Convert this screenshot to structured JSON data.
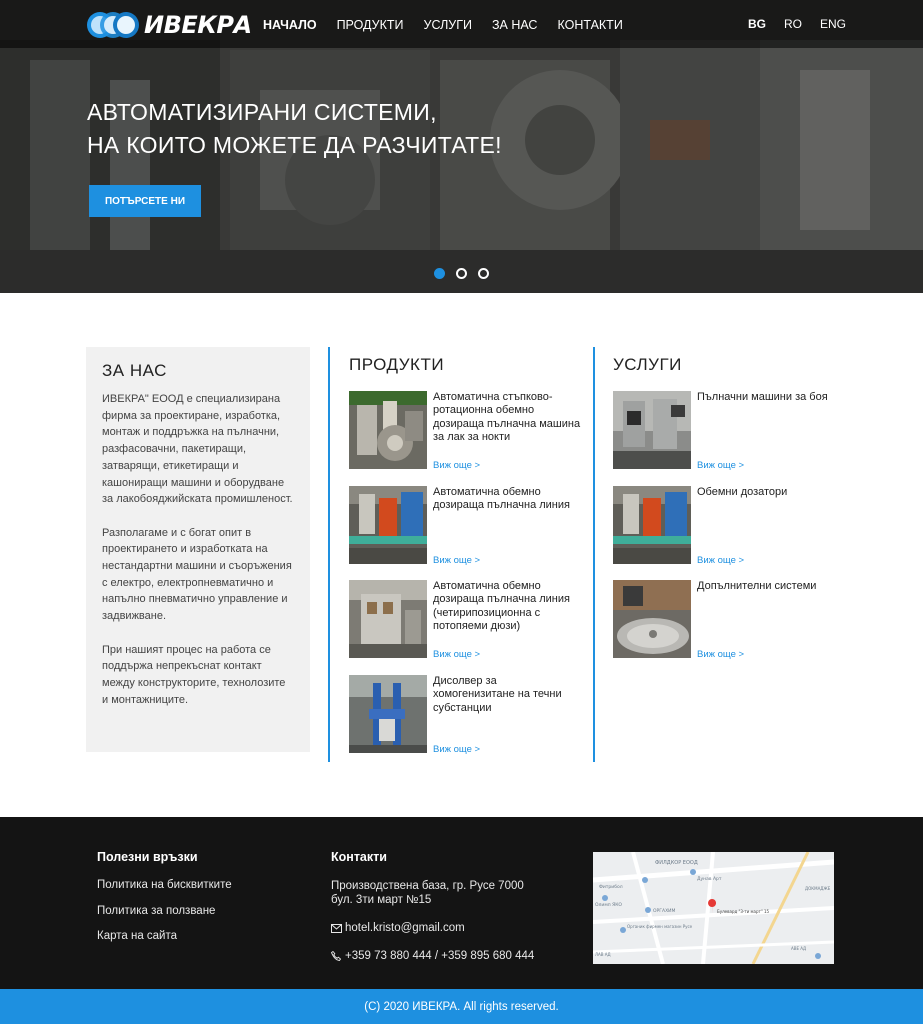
{
  "brand": {
    "name": "ИВЕКРА",
    "accent": "#1e90e0",
    "footer_bg": "#141414"
  },
  "nav": {
    "items": [
      "НАЧАЛО",
      "ПРОДУКТИ",
      "УСЛУГИ",
      "ЗА НАС",
      "КОНТАКТИ"
    ],
    "active": "НАЧАЛО"
  },
  "languages": {
    "items": [
      "BG",
      "RO",
      "ENG"
    ],
    "active": "BG"
  },
  "hero": {
    "title_line1": "АВТОМАТИЗИРАНИ СИСТЕМИ,",
    "title_line2": "НА КОИТО МОЖЕТЕ ДА РАЗЧИТАТЕ!",
    "button": "ПОТЪРСЕТЕ НИ",
    "slides": 3,
    "active_slide": 1
  },
  "about": {
    "title": "ЗА НАС",
    "paragraphs": [
      "ИВЕКРА\" ЕООД е специализирана фирма за проектиране, изработка, монтаж и поддръжка на пълначни, разфасовачни, пакетиращи, затварящи, етикетиращи и кашониращи машини и оборудване за лакобояджийската промишленост.",
      "Разполагаме и с богат опит в проектирането и изработката на нестандартни машини и съоръжения с електро, електропневматично и напълно пневматично управление и задвижване.",
      " При нашият процес на работа се поддържа непрекъснат контакт между конструкторите, технолозите и монтажниците."
    ]
  },
  "products": {
    "title": "ПРОДУКТИ",
    "link_label": "Виж още >",
    "items": [
      {
        "title": "Автоматична стъпково-ротационна обемно дозираща пълначна машина за лак за нокти",
        "thumb_icon": "filling-machine-photo"
      },
      {
        "title": "Автоматична обемно дозираща пълначна линия",
        "thumb_icon": "filling-line-photo"
      },
      {
        "title": "Автоматична обемно дозираща пълначна линия (четирипозиционна с потопяеми дюзи)",
        "thumb_icon": "four-position-line-photo"
      },
      {
        "title": "Дисолвер за хомогенизитане на течни субстанции",
        "thumb_icon": "dissolver-photo"
      }
    ]
  },
  "services": {
    "title": "УСЛУГИ",
    "link_label": "Виж още >",
    "items": [
      {
        "title": "Пълначни машини за боя",
        "thumb_icon": "paint-filler-photo"
      },
      {
        "title": "Обемни дозатори",
        "thumb_icon": "volumetric-doser-photo"
      },
      {
        "title": "Допълнителни системи",
        "thumb_icon": "additional-systems-photo"
      }
    ]
  },
  "footer": {
    "links_title": "Полезни връзки",
    "links": [
      "Политика на бисквитките",
      "Политика за ползване",
      "Карта на сайта"
    ],
    "contacts_title": "Контакти",
    "address_line1": "Производствена база, гр. Русе 7000",
    "address_line2": "бул. 3ти март №15",
    "email": "hotel.kristo@gmail.com",
    "phones": "+359 73 880 444  / +359 895 680 444",
    "map_labels": [
      "ФИЛДКОР ЕООД",
      "Фитрибол",
      "Дунав Арт",
      "Олимп ЯКО",
      "ОРГАХИМ",
      "Органик фирмен магазин Русе",
      "Булевард \"3-ти март\" 15",
      "ДОКМАДЖЕ",
      "АВЕ АД",
      "ЛАВ АД"
    ]
  },
  "copyright": "(C) 2020 ИВЕКРА. All rights reserved."
}
